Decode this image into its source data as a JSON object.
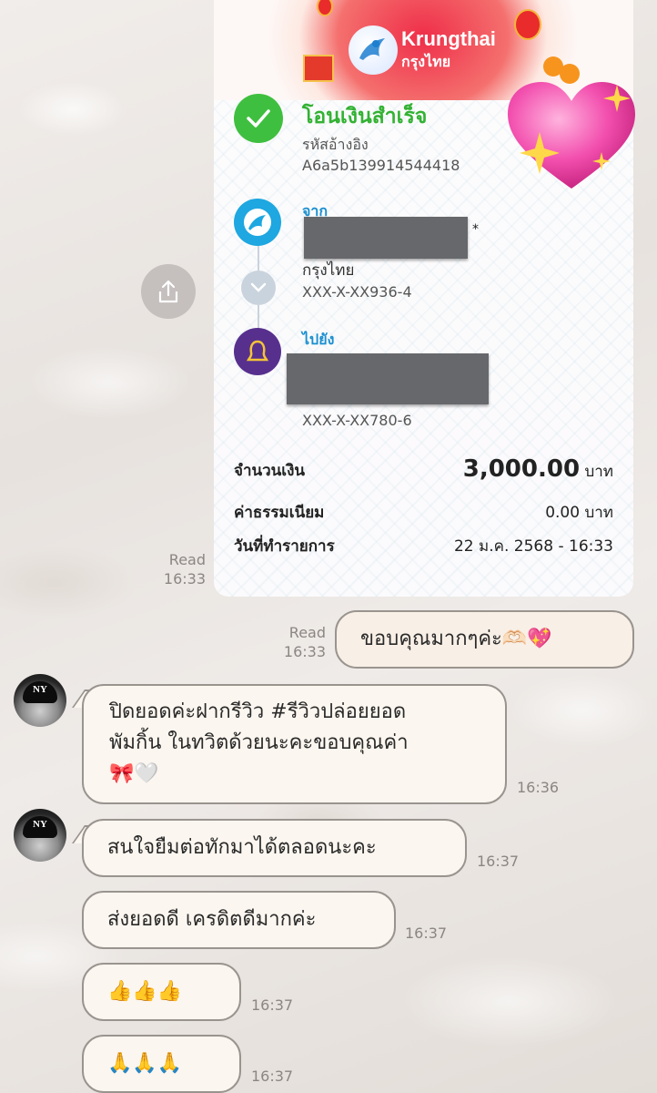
{
  "share": {
    "icon": "share-icon"
  },
  "receipt": {
    "brand": "Krungthai",
    "brand_thai": "กรุงไทย",
    "status": "โอนเงินสำเร็จ",
    "ref_label": "รหัสอ้างอิง",
    "ref_value": "A6a5b139914544418",
    "from_label": "จาก",
    "from_bank": "กรุงไทย",
    "from_account": "XXX-X-XX936-4",
    "from_suffix": "*",
    "to_label": "ไปยัง",
    "to_account": "XXX-X-XX780-6",
    "amount_label": "จำนวนเงิน",
    "amount_value": "3,000.00",
    "amount_unit": "บาท",
    "fee_label": "ค่าธรรมเนียม",
    "fee_value": "0.00 บาท",
    "date_label": "วันที่ทำรายการ",
    "date_value": "22 ม.ค. 2568 - 16:33"
  },
  "receipt_read": {
    "status": "Read",
    "time": "16:33"
  },
  "messages": [
    {
      "side": "out",
      "text": "ขอบคุณมากๆค่ะ🫶🏻💖",
      "read": "Read",
      "time": "16:33"
    },
    {
      "side": "in",
      "line1": "ปิดยอดค่ะฝากรีวิว #รีวิวปล่อยยอด",
      "line2": "พัมกิ้น ในทวิตด้วยนะคะขอบคุณค่า",
      "line3": "🎀🤍",
      "time": "16:36"
    },
    {
      "side": "in",
      "text": "สนใจยืมต่อทักมาได้ตลอดนะคะ",
      "time": "16:37"
    },
    {
      "side": "in",
      "text": "ส่งยอดดี เครดิตดีมากค่ะ",
      "time": "16:37"
    },
    {
      "side": "in",
      "text": "👍👍👍",
      "time": "16:37"
    },
    {
      "side": "in",
      "text": "🙏🙏🙏",
      "time": "16:37"
    }
  ],
  "colors": {
    "success": "#33b233",
    "brand_blue": "#1ea7e0",
    "scb_purple": "#57308e",
    "header_red": "#ef2e49"
  }
}
